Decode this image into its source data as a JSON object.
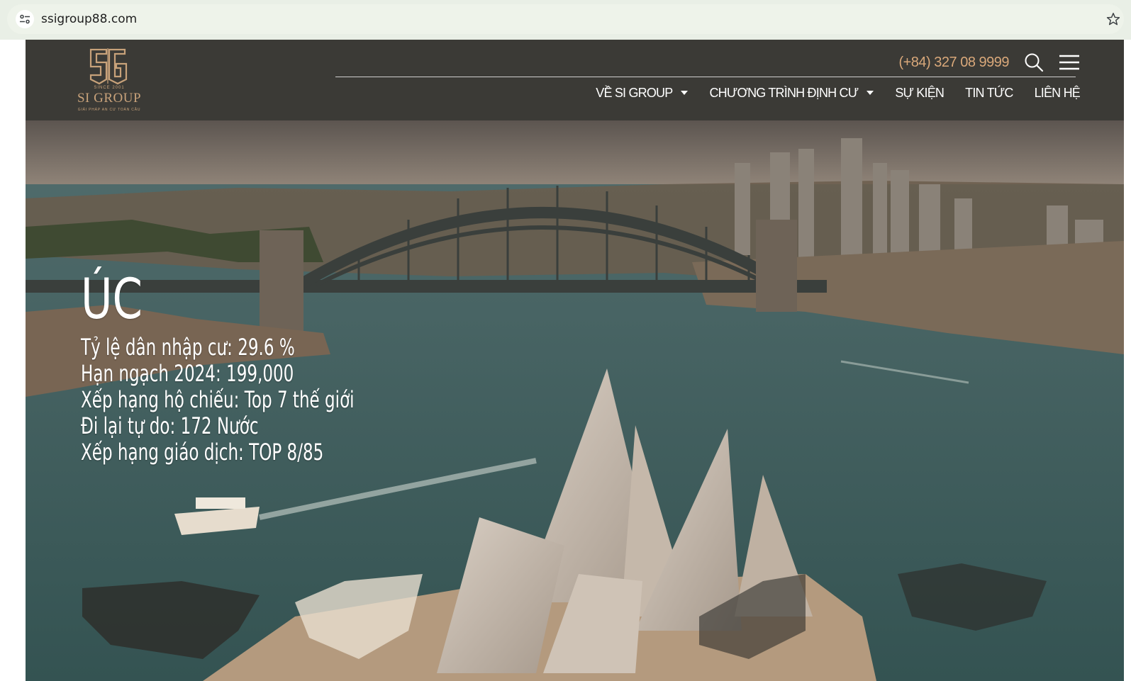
{
  "browser": {
    "url": "ssigroup88.com"
  },
  "logo": {
    "since": "SINCE 2001",
    "name": "SI GROUP",
    "tagline": "GIẢI PHÁP AN CƯ TOÀN CẦU"
  },
  "header": {
    "phone": "(+84) 327 08 9999",
    "nav": [
      {
        "label": "VỀ SI GROUP",
        "dropdown": true
      },
      {
        "label": "CHƯƠNG TRÌNH ĐỊNH CƯ",
        "dropdown": true
      },
      {
        "label": "SỰ KIỆN",
        "dropdown": false
      },
      {
        "label": "TIN TỨC",
        "dropdown": false
      },
      {
        "label": "LIÊN HỆ",
        "dropdown": false
      }
    ]
  },
  "hero": {
    "title": "ÚC",
    "stats": [
      "Tỷ lệ dân nhập cư: 29.6 %",
      "Hạn ngạch 2024: 199,000",
      "Xếp hạng hộ chiếu: Top 7 thế giới",
      "Đi lại tự do: 172 Nước",
      "Xếp hạng giáo dịch: TOP 8/85"
    ]
  },
  "colors": {
    "header_bg": "#3b3a36",
    "accent_gold": "#c8a27a",
    "phone_color": "#d9a87a",
    "nav_text": "#ffffff"
  },
  "icons": {
    "site_info": "tune-icon",
    "bookmark": "star-icon",
    "search": "search-icon",
    "menu": "hamburger-menu-icon",
    "dropdown": "caret-down-icon"
  }
}
